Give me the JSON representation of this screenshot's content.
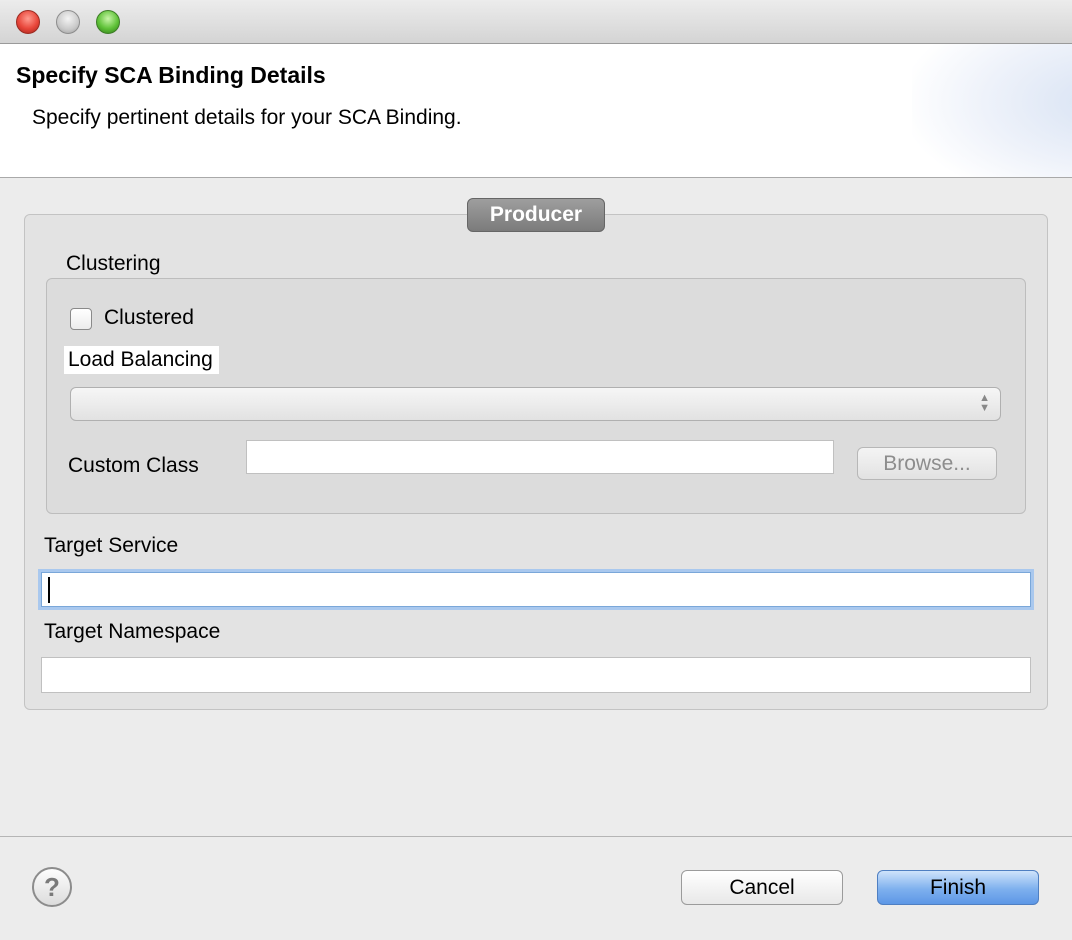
{
  "window": {
    "title": ""
  },
  "header": {
    "title": "Specify SCA Binding Details",
    "subtitle": "Specify pertinent details for your SCA Binding."
  },
  "producer_group": {
    "title": "Producer",
    "clustering": {
      "label": "Clustering",
      "clustered_checkbox": {
        "label": "Clustered",
        "checked": false
      },
      "load_balancing": {
        "label": "Load Balancing",
        "selected_value": ""
      },
      "custom_class": {
        "label": "Custom Class",
        "value": ""
      },
      "browse_button": {
        "label": "Browse..."
      }
    },
    "target_service": {
      "label": "Target Service",
      "value": ""
    },
    "target_namespace": {
      "label": "Target Namespace",
      "value": ""
    }
  },
  "footer": {
    "help_icon": "?",
    "cancel_button": "Cancel",
    "finish_button": "Finish"
  },
  "colors": {
    "accent_focus": "#a9c8ee",
    "finish_button": "#7eb0ee"
  }
}
